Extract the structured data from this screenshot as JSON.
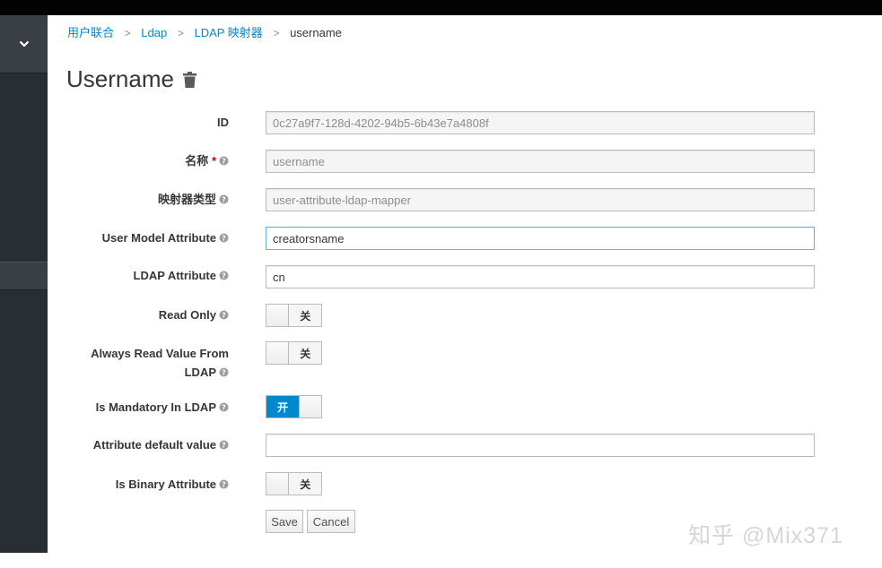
{
  "breadcrumb": {
    "items": [
      "用户联合",
      "Ldap",
      "LDAP 映射器"
    ],
    "separator": ">",
    "current": "username"
  },
  "page": {
    "title": "Username"
  },
  "form": {
    "id": {
      "label": "ID",
      "value": "0c27a9f7-128d-4202-94b5-6b43e7a4808f"
    },
    "name": {
      "label": "名称",
      "required_mark": "*",
      "value": "username"
    },
    "mapper_type": {
      "label": "映射器类型",
      "value": "user-attribute-ldap-mapper"
    },
    "user_model_attribute": {
      "label": "User Model Attribute",
      "value": "creatorsname"
    },
    "ldap_attribute": {
      "label": "LDAP Attribute",
      "value": "cn"
    },
    "read_only": {
      "label": "Read Only",
      "state": "关"
    },
    "always_read_value": {
      "label_line1": "Always Read Value From",
      "label_line2": "LDAP",
      "state": "关"
    },
    "is_mandatory": {
      "label": "Is Mandatory In LDAP",
      "state": "开"
    },
    "attribute_default_value": {
      "label": "Attribute default value",
      "value": ""
    },
    "is_binary": {
      "label": "Is Binary Attribute",
      "state": "关"
    }
  },
  "buttons": {
    "save": "Save",
    "cancel": "Cancel"
  },
  "watermark": "知乎 @Mix371",
  "colors": {
    "accent": "#0088ce",
    "sidebar": "#292e34",
    "topbar": "#030303"
  }
}
